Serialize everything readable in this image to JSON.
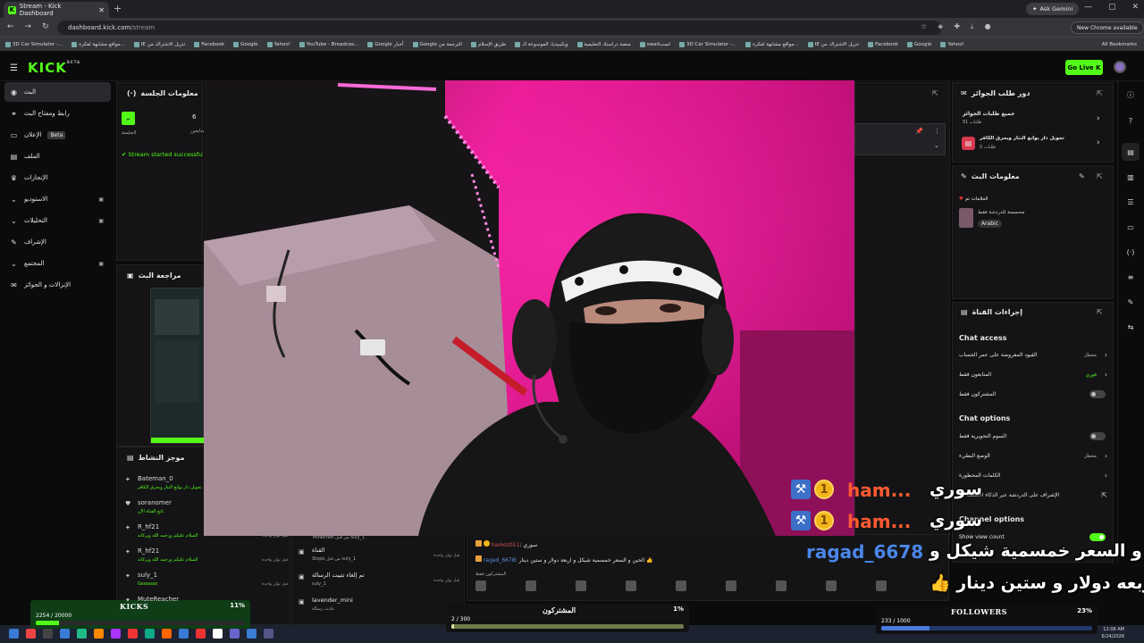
{
  "browser": {
    "tab_title": "Stream - Kick Dashboard",
    "url_host": "dashboard.kick.com",
    "url_path": "/stream",
    "ask_gemini": "Ask Gemini",
    "chrome_update": "New Chrome available",
    "bookmarks": [
      "3D Car Simulator -...",
      "مواقع مشابهة لفكرة...",
      "IE تنزيل الاشتراك من",
      "Facebook",
      "Google",
      "Yahoo!",
      "YouTube - Broadcas...",
      "Google أخبار",
      "Google الترجمة من",
      "طريق الإسلام",
      "ويكيبيديا، الموسوعة الـ",
      "منصة دراستك التعليمية",
      "swadلست",
      "3D Car Simulator -...",
      "مواقع مشابهة لفكرة...",
      "IE تنزيل الاشتراك من",
      "Facebook",
      "Google",
      "Yahoo!"
    ],
    "all_bookmarks": "All Bookmarks"
  },
  "header": {
    "logo": "KICK",
    "logo_beta": "BETA",
    "go_live": "Go Live"
  },
  "sidebar": {
    "items": [
      {
        "label": "البث",
        "icon": "broadcast-icon"
      },
      {
        "label": "رابط ومفتاح البث",
        "icon": "link-icon"
      },
      {
        "label": "الإعلان",
        "badge": "Beta",
        "icon": "ad-icon"
      },
      {
        "label": "الملف",
        "icon": "file-icon"
      },
      {
        "label": "الإنجازات",
        "icon": "trophy-icon"
      },
      {
        "label": "الاستوديو",
        "icon": "chevron-down-icon"
      },
      {
        "label": "التحليلات",
        "icon": "chevron-down-icon"
      },
      {
        "label": "الإشراف",
        "icon": "wrench-icon"
      },
      {
        "label": "المجتمع",
        "icon": "chevron-down-icon"
      },
      {
        "label": "الإنزالات و الجوائز",
        "icon": "gift-icon"
      }
    ]
  },
  "session": {
    "title": "معلومات الجلسة",
    "val1": "6",
    "lbl1": "الجلسة",
    "lbl2": "متابعين",
    "status": "Stream started successfully"
  },
  "preview": {
    "title": "مراجعة البث"
  },
  "activity": {
    "title": "موجز النشاط",
    "items": [
      {
        "name": "Bateman_0",
        "sub": "تحويل دار يوانغ النثار ويحرق الكافر",
        "time": ""
      },
      {
        "name": "soranomer",
        "sub": "تابع القناة الآن",
        "time": ""
      },
      {
        "name": "R_hf21",
        "sub": "السلام عليكم ورحمه الله وبركاته",
        "time": "قبل ثوان واحدة"
      },
      {
        "name": "R_hf21",
        "sub": "السلام عليكم ورحمه الله وبركاته",
        "time": "قبل ثوان واحدة"
      },
      {
        "name": "suly_1",
        "sub": "Gsssssss",
        "time": "قبل ثوان واحدة"
      },
      {
        "name": "MuteReacher",
        "sub": "",
        "time": ""
      }
    ]
  },
  "middle_list": {
    "items": [
      {
        "title": "القناة",
        "sub": "Stope من قبل suly_1",
        "time": "قبل ثوان واحدة"
      },
      {
        "title": "تم إلغاء تثبيت الرسالة",
        "sub": "suly_1",
        "time": "قبل ثوان واحدة"
      },
      {
        "title": "lavender_mini",
        "sub": "عادت رسالة",
        "time": ""
      }
    ],
    "top_line": "Minecraft من قبل suly_1"
  },
  "chat": {
    "lines": [
      {
        "user": "hamoz011",
        "text": "سوري"
      },
      {
        "user": "ragad_6678",
        "text": "الحين و السعر خمسمية شيكل و اربعة دولار و ستين دينار 👍"
      }
    ],
    "subs_label": "المشتركون فقط"
  },
  "rewards": {
    "title": "دور طلب الجوائز",
    "item1": "جميع طلبات الجوائز",
    "item1_sub": "طلبات 91",
    "item2": "تحويل دار يوانغ النثار ويحرق الكافر",
    "item2_sub": "طلبات 0"
  },
  "stream_info": {
    "title": "معلومات البث",
    "tags_label": "العلامات تم",
    "category": "محسسة للدردشة فقط",
    "language": "Arabic"
  },
  "channel_actions": {
    "title": "إجراءات القناة",
    "chat_access": "Chat access",
    "row1": "القيود المفروضة على عمر الحساب",
    "row1_val": "معطل",
    "row2": "المتابعون فقط",
    "row2_val": "فوري",
    "row3": "المشتركون فقط",
    "chat_options": "Chat options",
    "row4": "السوم التحويرية فقط",
    "row5": "الوضع البطيء",
    "row5_val": "معطل",
    "row6": "الكلمات المحظورة",
    "row7": "الإشراف على الدردشة عبر الذكاء الاصطناعي",
    "channel_options": "Channel options",
    "row8": "Show view count"
  },
  "overlay": {
    "alert1_name": "ham...",
    "alert1_text": "سوري",
    "alert2_name": "ham...",
    "alert2_text": "سوري",
    "alert3_name": "ragad_6678",
    "alert3_text": "الحين و السعر خمسمية شيكل و",
    "alert4_text": "اربعه دولار و ستين دينار 👍",
    "coin_rank": "1"
  },
  "goals": {
    "kicks": {
      "label": "KICKS",
      "current": "2254 / 20000",
      "percent": "11%",
      "progress": 0.11,
      "color": "#53fc18"
    },
    "subs": {
      "label": "المشتركون",
      "current": "2 / 300",
      "percent": "1%",
      "progress": 0.01,
      "color": "#d6e3a0"
    },
    "followers": {
      "label": "FOLLOWERS",
      "current": "233 / 1000",
      "percent": "23%",
      "progress": 0.23,
      "color": "#4a7bdc"
    }
  },
  "taskbar": {
    "time": "12:08 AM",
    "date": "6/24/2026"
  }
}
